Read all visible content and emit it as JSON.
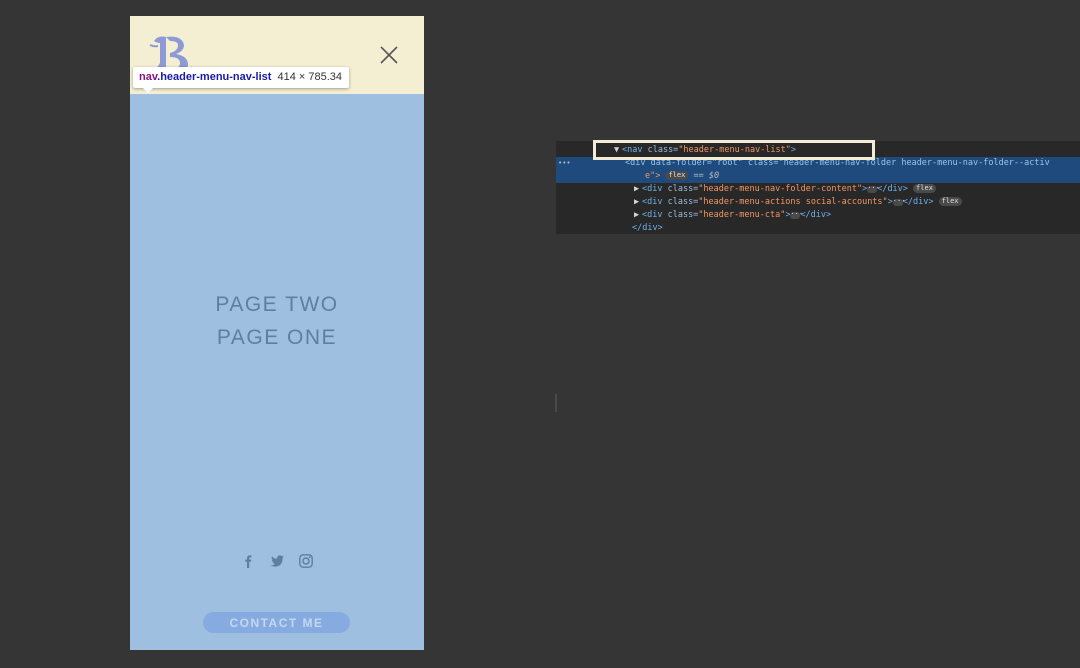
{
  "preview": {
    "tooltip": {
      "tag": "nav",
      "class_name": ".header-menu-nav-list",
      "dimensions": "414 × 785.34"
    },
    "nav_links": [
      "PAGE TWO",
      "PAGE ONE"
    ],
    "social_icons": [
      "facebook-icon",
      "twitter-icon",
      "instagram-icon"
    ],
    "cta_label": "CONTACT ME",
    "colors": {
      "header_bg": "#f4efd3",
      "menu_bg": "#9ebfdf",
      "link": "#5f7f9e",
      "cta_bg": "#86abe0",
      "logo": "#8d9ad6"
    }
  },
  "devtools": {
    "nav_line": {
      "open": "<nav ",
      "attr": "class=",
      "value": "\"header-menu-nav-list\"",
      "close": ">"
    },
    "folder_line1": "<div data-folder=\"root\" class=\"header-menu-nav-folder header-menu-nav-folder--activ",
    "folder_line2_pre": "e\">",
    "flex_label": "flex",
    "eq_text": "== $0",
    "rows": [
      {
        "open": "<div ",
        "attr": "class=",
        "value": "\"header-menu-nav-folder-content\"",
        "tail": "</div>",
        "pill": "flex"
      },
      {
        "open": "<div ",
        "attr": "class=",
        "value": "\"header-menu-actions social-accounts\"",
        "tail": "</div>",
        "pill": "flex"
      },
      {
        "open": "<div ",
        "attr": "class=",
        "value": "\"header-menu-cta\"",
        "tail": "</div>",
        "pill": ""
      }
    ],
    "closing": "</div>"
  }
}
